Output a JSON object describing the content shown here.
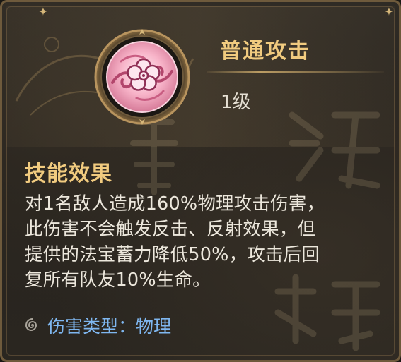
{
  "skill": {
    "name": "普通攻击",
    "level": "1级",
    "icon": "pink-flower-orb-icon"
  },
  "effect": {
    "heading": "技能效果",
    "lines": [
      "对1名敌人造成160%物理攻击伤害，",
      "此伤害不会触发反击、反射效果，但",
      "提供的法宝蓄力降低50%，攻击后回",
      "复所有队友10%生命。"
    ]
  },
  "damage_type": {
    "icon": "swirl-icon",
    "label": "伤害类型：物理"
  },
  "colors": {
    "title_gold": "#f1cb7f",
    "body_text": "#ece7dc",
    "damage_blue": "#7fb7f0",
    "panel_bg": "#2b2721",
    "border_bronze": "#6e5a3c",
    "flower_pink": "#f7b3c8"
  }
}
